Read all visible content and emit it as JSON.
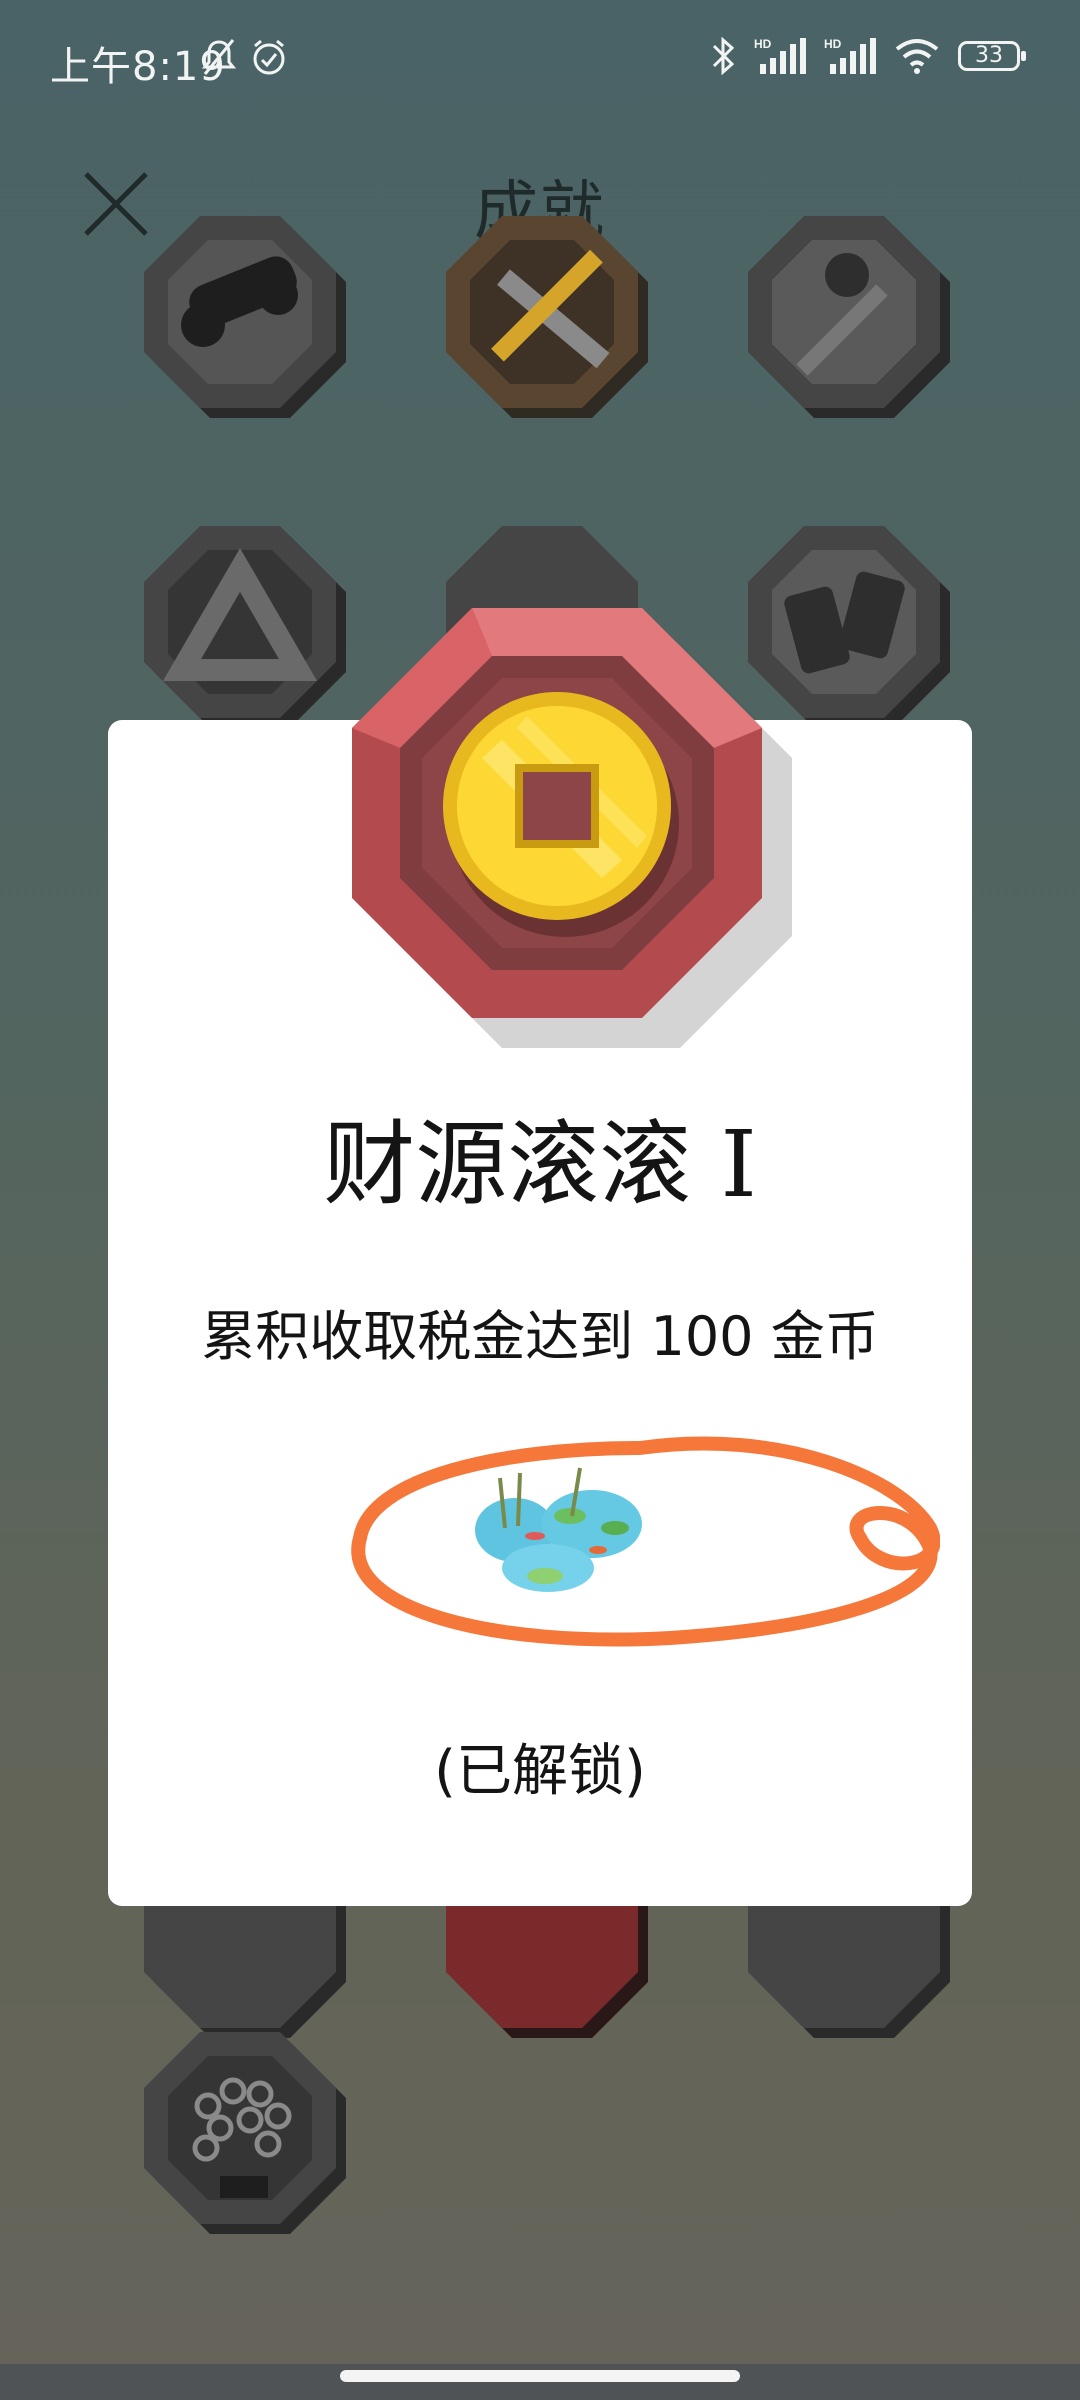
{
  "status_bar": {
    "time": "上午8:19",
    "battery": "33",
    "icons": [
      "bell-muted-icon",
      "alarm-icon",
      "bluetooth-icon",
      "signal-hd-1-icon",
      "signal-hd-2-icon",
      "wifi-icon",
      "battery-icon"
    ]
  },
  "header": {
    "title": "成就",
    "close_icon": "close-icon"
  },
  "badges": [
    {
      "name": "gamepad",
      "icon": "gamepad-icon",
      "tone": "gray"
    },
    {
      "name": "tools",
      "icon": "pencil-ruler-icon",
      "tone": "brown"
    },
    {
      "name": "flowers",
      "icon": "flower-icon",
      "tone": "gray"
    },
    {
      "name": "triangle",
      "icon": "impossible-triangle-icon",
      "tone": "gray"
    },
    {
      "name": "cans",
      "icon": "soda-cans-icon",
      "tone": "gray"
    },
    {
      "name": "money-tree",
      "icon": "money-tree-icon",
      "tone": "gray"
    }
  ],
  "modal": {
    "title": "财源滚滚 I",
    "description": "累积收取税金达到 100 金币",
    "reward_icon": "koi-pond-icon",
    "status": "(已解锁)",
    "badge_icon": "gold-coin-icon",
    "colors": {
      "badge_red": "#d9646a",
      "badge_dark": "#7a3c3e",
      "coin_gold": "#fdd835",
      "highlight_orange": "#f5783a"
    }
  }
}
